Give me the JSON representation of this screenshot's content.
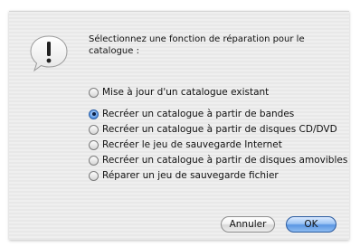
{
  "dialog": {
    "icon": "alert-icon",
    "message": "Sélectionnez une fonction de réparation pour le catalogue :",
    "options": [
      {
        "label": "Mise à jour d'un catalogue existant",
        "selected": false
      },
      {
        "label": "Recréer un catalogue à partir de bandes",
        "selected": true
      },
      {
        "label": "Recréer un catalogue à partir de disques CD/DVD",
        "selected": false
      },
      {
        "label": "Recréer le jeu de sauvegarde Internet",
        "selected": false
      },
      {
        "label": "Recréer un catalogue à partir de disques amovibles",
        "selected": false
      },
      {
        "label": "Réparer un jeu de sauvegarde fichier",
        "selected": false
      }
    ],
    "buttons": {
      "cancel_label": "Annuler",
      "ok_label": "OK"
    }
  },
  "colors": {
    "accent": "#5a96e2",
    "sheet_background": "#ececec"
  }
}
